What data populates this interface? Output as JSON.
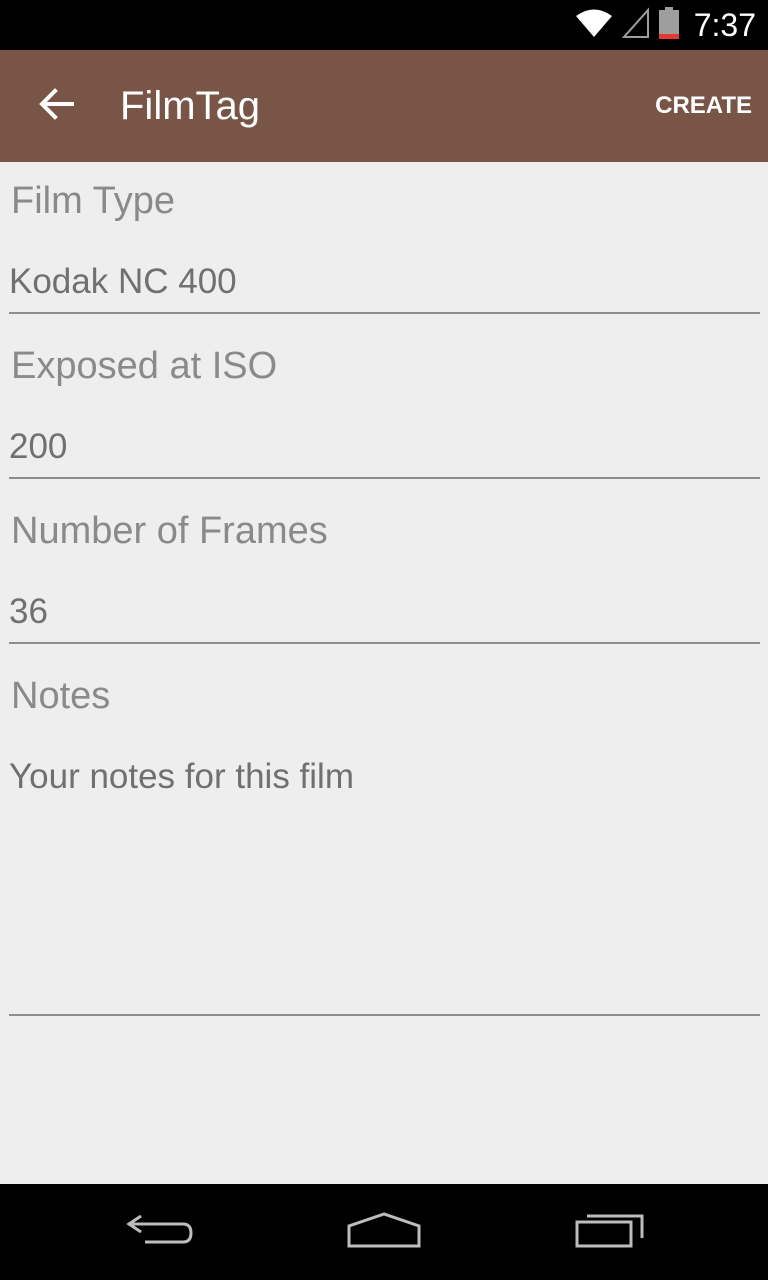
{
  "status_bar": {
    "time": "7:37",
    "icons": [
      "wifi-icon",
      "signal-icon",
      "battery-icon"
    ]
  },
  "app_bar": {
    "title": "FilmTag",
    "back_icon": "arrow-back-icon",
    "action_label": "CREATE",
    "background": "#795548"
  },
  "form": {
    "film_type": {
      "label": "Film Type",
      "value": "Kodak NC 400"
    },
    "iso": {
      "label": "Exposed at ISO",
      "value": "200"
    },
    "frames": {
      "label": "Number of Frames",
      "value": "36"
    },
    "notes": {
      "label": "Notes",
      "placeholder": "Your notes for this film"
    }
  },
  "nav_bar": {
    "buttons": [
      "back-nav-icon",
      "home-nav-icon",
      "recents-nav-icon"
    ]
  }
}
